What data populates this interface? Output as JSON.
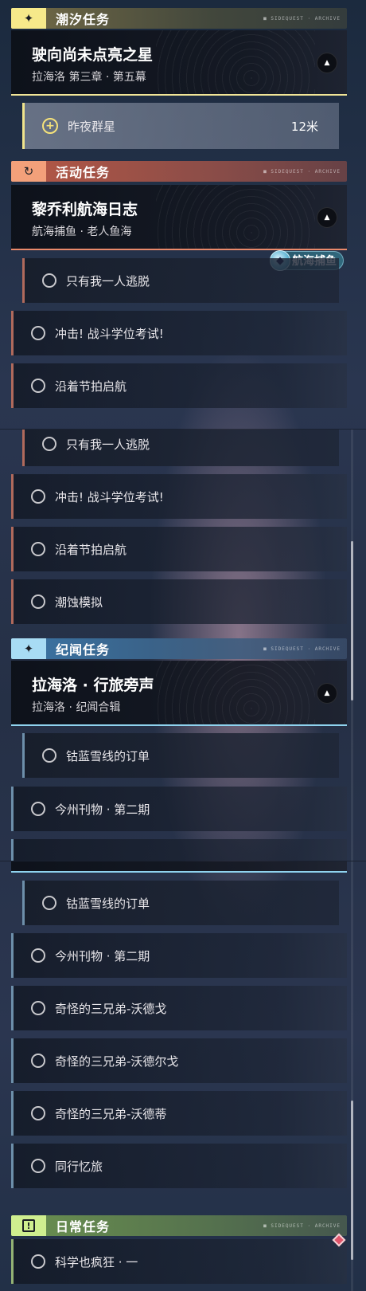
{
  "sections": {
    "tide": {
      "title": "潮汐任务",
      "tag": "■ SIDEQUEST  ·  ARCHIVE"
    },
    "event": {
      "title": "活动任务",
      "tag": "■ SIDEQUEST  ·  ARCHIVE"
    },
    "chronicle": {
      "title": "纪闻任务",
      "tag": "■ SIDEQUEST  ·  ARCHIVE"
    },
    "daily": {
      "title": "日常任务",
      "tag": "■ SIDEQUEST  ·  ARCHIVE"
    }
  },
  "cards": {
    "tide_main": {
      "title": "驶向尚未点亮之星",
      "subtitle": "拉海洛 第三章 · 第五幕"
    },
    "event_main": {
      "title": "黎乔利航海日志",
      "subtitle": "航海捕鱼 · 老人鱼海"
    },
    "chronicle_main": {
      "title": "拉海洛 · 行旅旁声",
      "subtitle": "拉海洛 · 纪闻合辑"
    }
  },
  "active_quest": {
    "label": "昨夜群星",
    "distance": "12米"
  },
  "badge": {
    "label": "航海捕鱼"
  },
  "event_quests": [
    "只有我一人逃脱",
    "冲击! 战斗学位考试!",
    "沿着节拍启航",
    "潮蚀模拟"
  ],
  "chronicle_quests": [
    "钴蓝雪线的订单",
    "今州刊物 · 第二期",
    "奇怪的三兄弟-沃德戈",
    "奇怪的三兄弟-沃德尔戈",
    "奇怪的三兄弟-沃德蒂",
    "同行忆旅"
  ],
  "daily_quests": [
    "科学也疯狂 · 一"
  ],
  "icons": {
    "tide": "star-sparkle-icon",
    "event": "cycle-arrow-icon",
    "chronicle": "star-sparkle-icon",
    "daily": "exclamation-box-icon",
    "collapse": "triangle-up-icon",
    "quest_todo": "circle-outline-icon",
    "quest_track": "circle-plus-icon",
    "fish": "fish-icon",
    "alert": "diamond-icon"
  },
  "colors": {
    "tide": "#f6e98a",
    "event": "#f3a07a",
    "chronicle": "#a8dcf4",
    "daily": "#cfee8f"
  }
}
